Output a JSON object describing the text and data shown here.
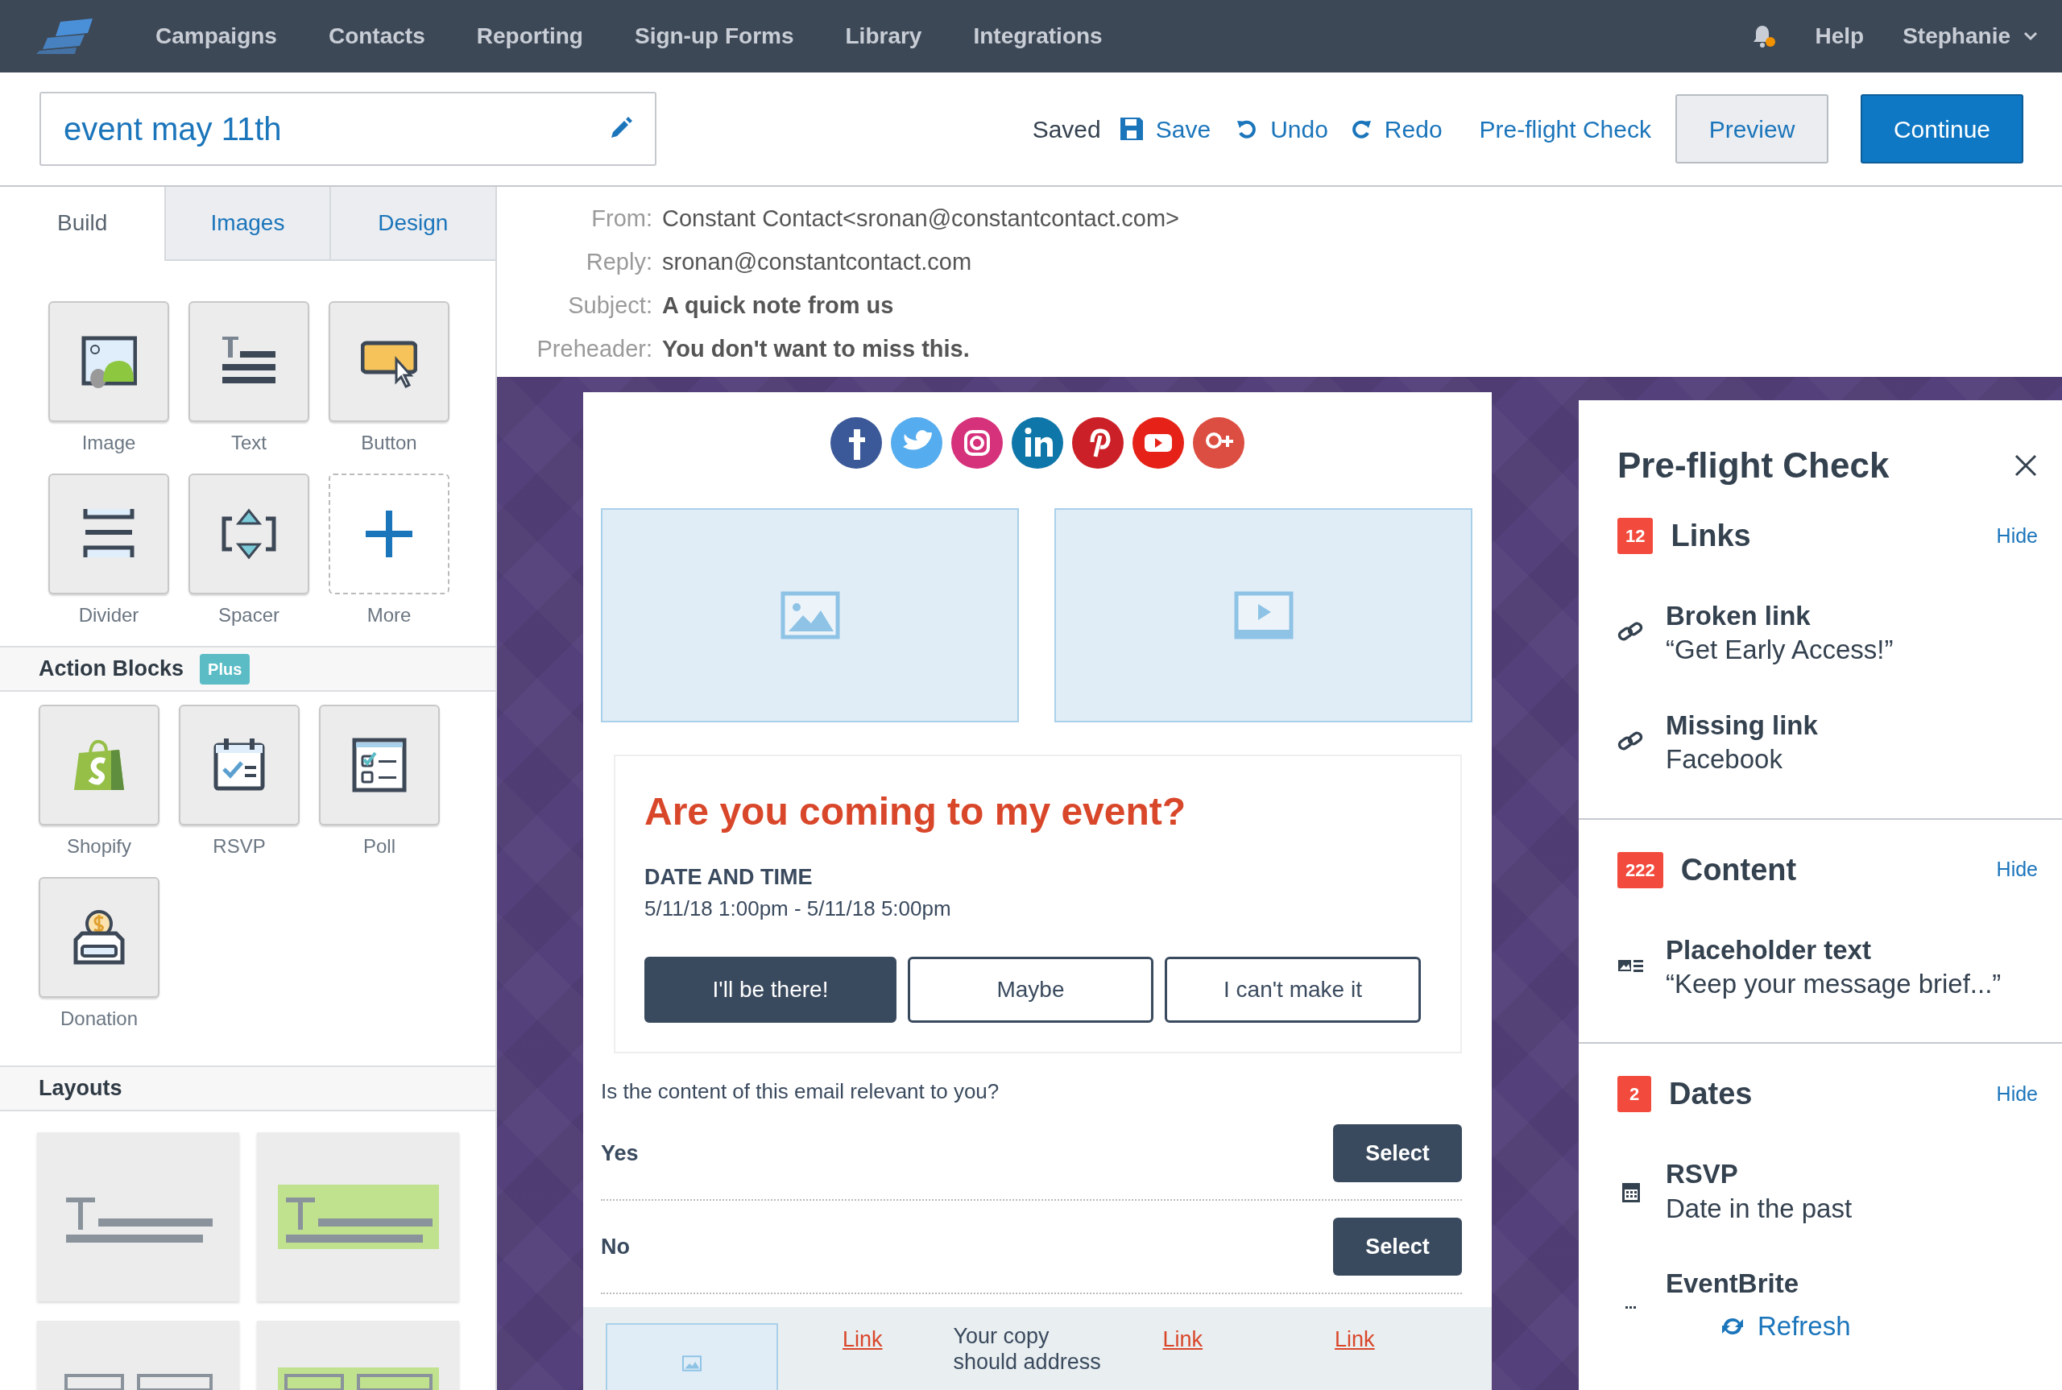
{
  "nav": {
    "items": [
      "Campaigns",
      "Contacts",
      "Reporting",
      "Sign-up Forms",
      "Library",
      "Integrations"
    ],
    "notification": true,
    "help": "Help",
    "user": "Stephanie"
  },
  "toolbar": {
    "title": "event may 11th",
    "status": "Saved",
    "save": "Save",
    "undo": "Undo",
    "redo": "Redo",
    "preflight": "Pre-flight Check",
    "preview": "Preview",
    "continue": "Continue"
  },
  "left_panel": {
    "tabs": [
      {
        "label": "Build",
        "selected": true
      },
      {
        "label": "Images",
        "selected": false
      },
      {
        "label": "Design",
        "selected": false
      }
    ],
    "blocks": [
      {
        "label": "Image",
        "kind": "block"
      },
      {
        "label": "Text",
        "kind": "block"
      },
      {
        "label": "Button",
        "kind": "block"
      },
      {
        "label": "Divider",
        "kind": "block"
      },
      {
        "label": "Spacer",
        "kind": "block"
      },
      {
        "label": "More",
        "kind": "add"
      }
    ],
    "action_blocks": {
      "title": "Action Blocks",
      "badge": "Plus",
      "items": [
        "Shopify",
        "RSVP",
        "Poll",
        "Donation"
      ]
    },
    "layouts": {
      "title": "Layouts",
      "tiles": [
        {
          "highlighted": false
        },
        {
          "highlighted": true
        },
        {
          "highlighted": false
        },
        {
          "highlighted": true
        }
      ]
    }
  },
  "email_header": [
    {
      "label": "From:",
      "value": "Constant Contact<sronan@constantcontact.com>",
      "bold": false
    },
    {
      "label": "Reply:",
      "value": "sronan@constantcontact.com",
      "bold": false
    },
    {
      "label": "Subject:",
      "value": "A quick note from us",
      "bold": true
    },
    {
      "label": "Preheader:",
      "value": "You don't want to miss this.",
      "bold": true
    }
  ],
  "email": {
    "event": {
      "title": "Are you coming to my event?",
      "date_label": "DATE AND TIME",
      "date": "5/11/18 1:00pm - 5/11/18 5:00pm",
      "buttons": [
        {
          "label": "I'll be there!",
          "filled": true
        },
        {
          "label": "Maybe",
          "filled": false
        },
        {
          "label": "I can't make it",
          "filled": false
        }
      ]
    },
    "poll": {
      "question": "Is the content of this email relevant to you?",
      "options": [
        {
          "label": "Yes",
          "button": "Select"
        },
        {
          "label": "No",
          "button": "Select"
        }
      ]
    },
    "footer": {
      "link_1": "Link",
      "copy": "Your copy should address",
      "link_2": "Link",
      "link_3": "Link"
    }
  },
  "preflight": {
    "title": "Pre-flight Check",
    "sections": [
      {
        "count": "12",
        "title": "Links",
        "hide": "Hide",
        "items": [
          {
            "kind": "link",
            "title": "Broken link",
            "detail": "“Get Early Access!”"
          },
          {
            "kind": "link",
            "title": "Missing link",
            "detail": "Facebook"
          }
        ]
      },
      {
        "count": "222",
        "title": "Content",
        "hide": "Hide",
        "items": [
          {
            "kind": "content",
            "title": "Placeholder text",
            "detail": "“Keep your message brief...”"
          }
        ]
      },
      {
        "count": "2",
        "title": "Dates",
        "hide": "Hide",
        "items": [
          {
            "kind": "calendar",
            "title": "RSVP",
            "detail": "Date in the past"
          },
          {
            "kind": "more",
            "title": "EventBrite",
            "action": "Refresh"
          }
        ]
      }
    ]
  }
}
